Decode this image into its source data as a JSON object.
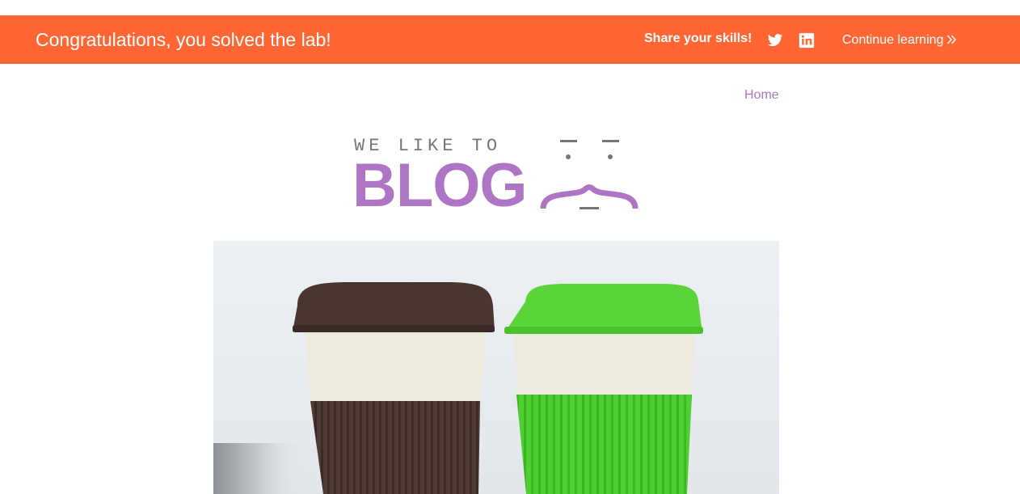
{
  "banner": {
    "title": "Congratulations, you solved the lab!",
    "share_label": "Share your skills!",
    "icons": [
      "twitter-icon",
      "linkedin-icon"
    ],
    "continue_label": "Continue learning",
    "background_color": "#ff6633"
  },
  "nav": {
    "home_label": "Home",
    "link_color": "#ae75c5"
  },
  "logo": {
    "top_text": "WE LIKE TO",
    "main_text": "BLOG"
  },
  "hero": {
    "description": "Two reusable coffee cups: brown and green"
  }
}
